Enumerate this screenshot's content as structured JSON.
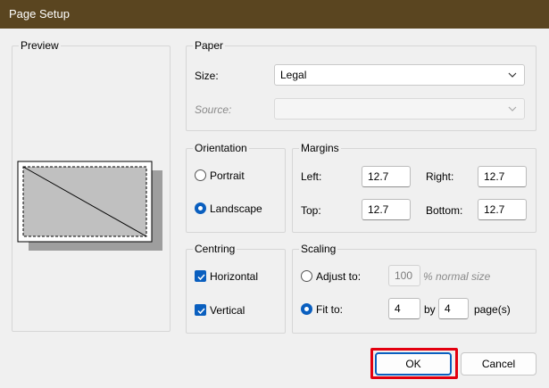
{
  "window": {
    "title": "Page Setup"
  },
  "preview": {
    "legend": "Preview"
  },
  "paper": {
    "legend": "Paper",
    "size_label": "Size:",
    "size_value": "Legal",
    "source_label": "Source:",
    "source_value": ""
  },
  "orientation": {
    "legend": "Orientation",
    "portrait_label": "Portrait",
    "landscape_label": "Landscape"
  },
  "margins": {
    "legend": "Margins",
    "left_label": "Left:",
    "left_value": "12.7",
    "right_label": "Right:",
    "right_value": "12.7",
    "top_label": "Top:",
    "top_value": "12.7",
    "bottom_label": "Bottom:",
    "bottom_value": "12.7"
  },
  "centring": {
    "legend": "Centring",
    "horizontal_label": "Horizontal",
    "vertical_label": "Vertical"
  },
  "scaling": {
    "legend": "Scaling",
    "adjust_label": "Adjust to:",
    "adjust_value": "100",
    "adjust_suffix": "% normal size",
    "fit_label": "Fit to:",
    "fit_w": "4",
    "by_label": "by",
    "fit_h": "4",
    "pages_suffix": "page(s)"
  },
  "buttons": {
    "ok_label": "OK",
    "cancel_label": "Cancel"
  },
  "colors": {
    "titlebar": "#5a4520",
    "accent": "#0a5fbf",
    "highlight": "#e3000f"
  }
}
